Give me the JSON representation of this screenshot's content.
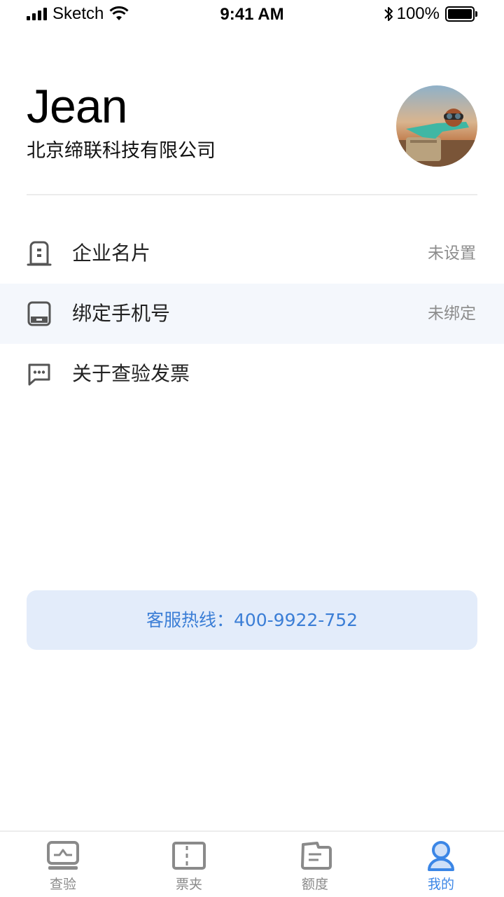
{
  "status_bar": {
    "carrier": "Sketch",
    "time": "9:41 AM",
    "battery_percent": "100%"
  },
  "profile": {
    "name": "Jean",
    "company": "北京缔联科技有限公司",
    "avatar_icon": "user-avatar-photo"
  },
  "menu": {
    "items": [
      {
        "label": "企业名片",
        "value": "未设置",
        "icon": "business-card-icon"
      },
      {
        "label": "绑定手机号",
        "value": "未绑定",
        "icon": "phone-icon"
      },
      {
        "label": "关于查验发票",
        "value": "",
        "icon": "chat-bubble-icon"
      }
    ]
  },
  "hotline": {
    "text": "客服热线：400-9922-752"
  },
  "tab_bar": {
    "tabs": [
      {
        "label": "查验",
        "icon": "monitor-icon",
        "active": false
      },
      {
        "label": "票夹",
        "icon": "ticket-icon",
        "active": false
      },
      {
        "label": "额度",
        "icon": "quota-icon",
        "active": false
      },
      {
        "label": "我的",
        "icon": "person-icon",
        "active": true
      }
    ]
  },
  "colors": {
    "accent": "#3b86e6",
    "hotline_bg": "#e3ecfa",
    "highlight_row": "#f4f7fc",
    "icon_gray": "#555555",
    "muted_text": "#8c8c8c"
  }
}
